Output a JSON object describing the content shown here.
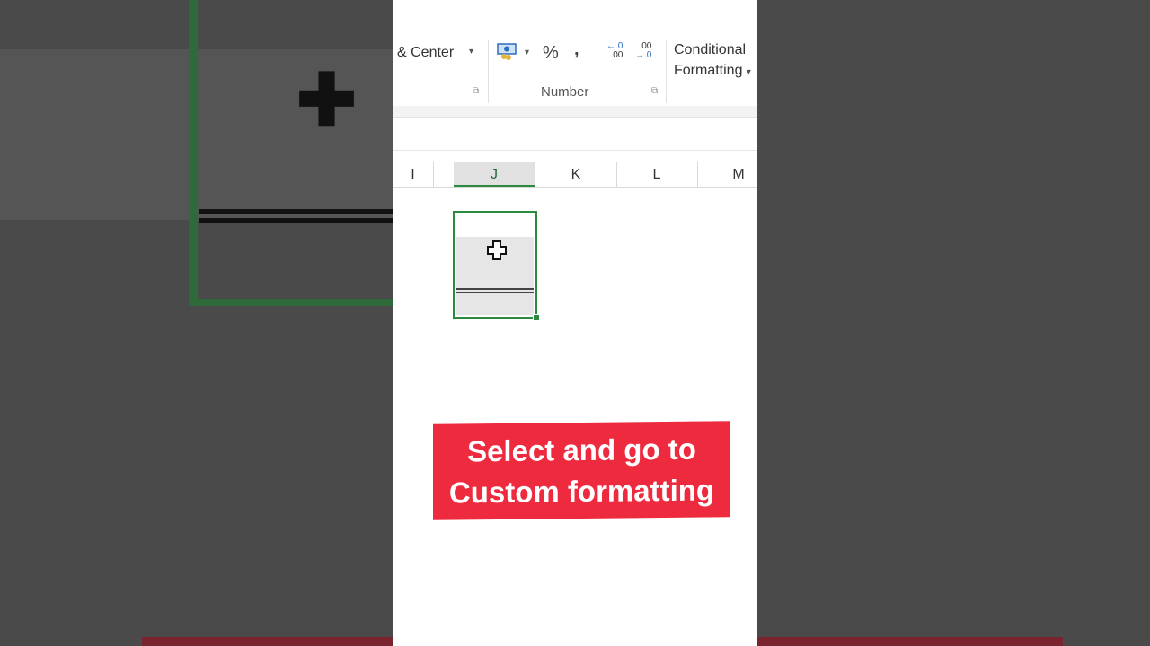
{
  "ribbon": {
    "merge_label": "& Center",
    "percent_symbol": "%",
    "comma_symbol": ",",
    "increase_decimal": {
      "top": "←.0",
      "bottom": ".00"
    },
    "decrease_decimal": {
      "top": ".00",
      "bottom": "→.0"
    },
    "group_label": "Number",
    "conditional_line1": "Conditional",
    "conditional_line2": "Formatting",
    "dropdown_glyph": "▾",
    "launcher_glyph": "⧉"
  },
  "columns": [
    {
      "label": "I",
      "selected": false
    },
    {
      "label": "J",
      "selected": true
    },
    {
      "label": "K",
      "selected": false
    },
    {
      "label": "L",
      "selected": false
    },
    {
      "label": "M",
      "selected": false
    }
  ],
  "banner": {
    "line1": "Select and go to",
    "line2": "Custom formatting",
    "color": "#ee2a3f"
  },
  "colors": {
    "selection_green": "#2b8a3e",
    "background_dim": "#4b4b4b"
  }
}
